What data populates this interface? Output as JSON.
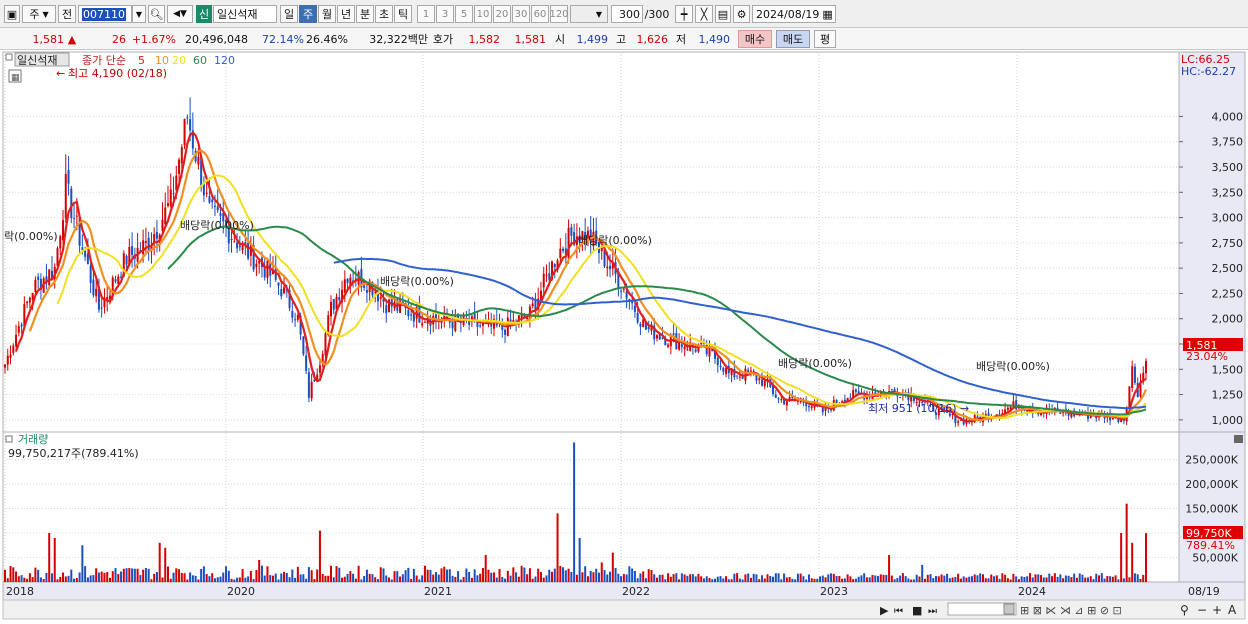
{
  "toolbar": {
    "market_label": "주",
    "prev_label": "전",
    "code_value": "007110",
    "market_badge": "신",
    "stock_name": "일신석재",
    "periods": [
      "일",
      "주",
      "월",
      "년",
      "분",
      "초",
      "틱"
    ],
    "active_period": "주",
    "intervals": [
      "1",
      "3",
      "5",
      "10",
      "20",
      "30",
      "60",
      "120"
    ],
    "count_value": "300",
    "count_total": "/300",
    "date_value": "2024/08/19"
  },
  "quote": {
    "price": "1,581",
    "arrow": "▲",
    "change": "26",
    "change_pct": "+1.67%",
    "volume": "20,496,048",
    "ratio1": "72.14%",
    "ratio2": "26.46%",
    "amount": "32,322백만",
    "ask_label": "호가",
    "ask1": "1,582",
    "ask2": "1,581",
    "open_label": "시",
    "open": "1,499",
    "high_label": "고",
    "high": "1,626",
    "low_label": "저",
    "low": "1,490",
    "buy_label": "매수",
    "sell_label": "매도",
    "avg_label": "평"
  },
  "price_panel": {
    "stock_tag": "일신석재",
    "ma_title": "종가 단순",
    "ma_periods": [
      "5",
      "10",
      "20",
      "60",
      "120"
    ],
    "ma_colors": [
      "#e02020",
      "#f09020",
      "#f0e020",
      "#2a8a4a",
      "#3060d0"
    ],
    "max_annotation": "최고 4,190 (02/18)",
    "min_annotation": "최저 951 (10/16)",
    "dividend_label": "배당락(0.00%)",
    "dividend_label_clipped": "락(0.00%)",
    "lc_label": "LC:66.25",
    "hc_label": "HC:-62.27",
    "current_price_tag": "1,581",
    "current_pct_tag": "23.04%",
    "y_ticks": [
      "4,000",
      "3,750",
      "3,500",
      "3,250",
      "3,000",
      "2,750",
      "2,500",
      "2,250",
      "2,000",
      "1,750",
      "1,500",
      "1,250",
      "1,000"
    ]
  },
  "volume_panel": {
    "title": "거래량",
    "summary": "99,750,217주(789.41%)",
    "y_ticks": [
      "250,000K",
      "200,000K",
      "150,000K",
      "100,000K",
      "50,000K"
    ],
    "current_tag": "99,750K",
    "current_pct": "789.41%"
  },
  "x_axis": {
    "labels": [
      "2018",
      "2020",
      "2021",
      "2022",
      "2023",
      "2024"
    ],
    "end_label": "08/19"
  },
  "chart_data": {
    "type": "candlestick",
    "price_range": [
      880,
      4380
    ],
    "volume_range": [
      0,
      290000
    ],
    "moving_averages": [
      "5",
      "10",
      "20",
      "60",
      "120"
    ],
    "price_high": 4190,
    "price_low": 951,
    "last_close": 1581,
    "last_volume_k": 99750
  },
  "colors": {
    "up": "#d40000",
    "down": "#1a4fc0",
    "accent_bg": "#e8e8f8"
  }
}
